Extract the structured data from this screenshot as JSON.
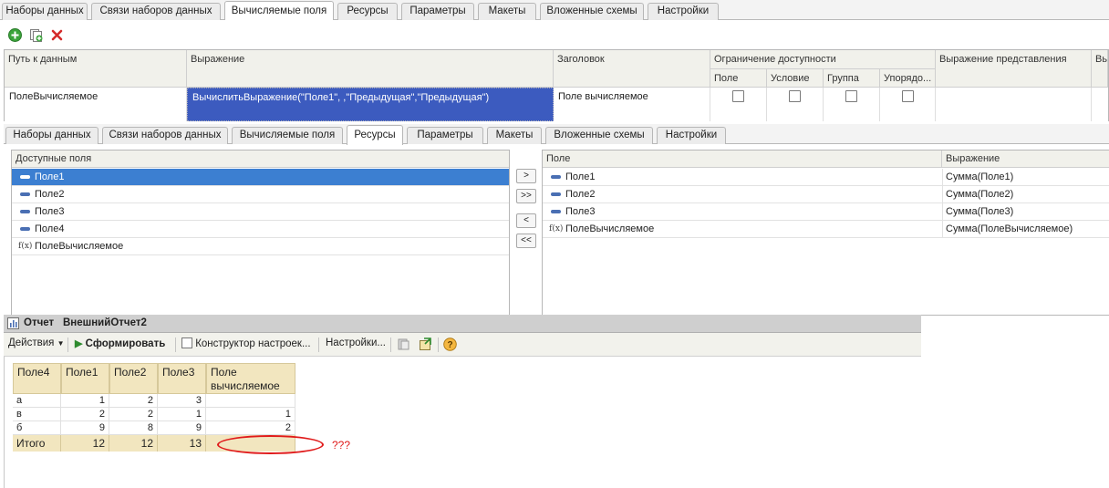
{
  "top_tabs": [
    "Наборы данных",
    "Связи наборов данных",
    "Вычисляемые поля",
    "Ресурсы",
    "Параметры",
    "Макеты",
    "Вложенные схемы",
    "Настройки"
  ],
  "top_active_tab": "Вычисляемые поля",
  "calc_fields": {
    "headers": {
      "path": "Путь к данным",
      "expression": "Выражение",
      "title": "Заголовок",
      "restriction": "Ограничение доступности",
      "restriction_field": "Поле",
      "restriction_condition": "Условие",
      "restriction_group": "Группа",
      "restriction_order": "Упорядо...",
      "presentation": "Выражение представления",
      "cut": "Вы"
    },
    "row": {
      "path": "ПолеВычисляемое",
      "expression": "ВычислитьВыражение(\"Поле1\", ,\"Предыдущая\",\"Предыдущая\")",
      "title": "Поле вычисляемое"
    }
  },
  "inner_tabs": [
    "Наборы данных",
    "Связи наборов данных",
    "Вычисляемые поля",
    "Ресурсы",
    "Параметры",
    "Макеты",
    "Вложенные схемы",
    "Настройки"
  ],
  "inner_active_tab": "Ресурсы",
  "available_fields": {
    "header": "Доступные поля",
    "items": [
      "Поле1",
      "Поле2",
      "Поле3",
      "Поле4",
      "ПолеВычисляемое"
    ]
  },
  "move_buttons": [
    ">",
    ">>",
    "<",
    "<<"
  ],
  "resources": {
    "header_field": "Поле",
    "header_expression": "Выражение",
    "rows": [
      {
        "field": "Поле1",
        "expression": "Сумма(Поле1)"
      },
      {
        "field": "Поле2",
        "expression": "Сумма(Поле2)"
      },
      {
        "field": "Поле3",
        "expression": "Сумма(Поле3)"
      },
      {
        "field": "ПолеВычисляемое",
        "expression": "Сумма(ПолеВычисляемое)"
      }
    ]
  },
  "report": {
    "title_prefix": "Отчет",
    "title": "ВнешнийОтчет2",
    "actions_label": "Действия",
    "generate_label": "Сформировать",
    "constructor_label": "Конструктор настроек...",
    "settings_label": "Настройки..."
  },
  "result_table": {
    "headers": [
      "Поле4",
      "Поле1",
      "Поле2",
      "Поле3",
      "Поле вычисляемое"
    ],
    "rows": [
      [
        "а",
        "1",
        "2",
        "3",
        ""
      ],
      [
        "в",
        "2",
        "2",
        "1",
        "1"
      ],
      [
        "б",
        "9",
        "8",
        "9",
        "2"
      ]
    ],
    "total": [
      "Итого",
      "12",
      "12",
      "13",
      ""
    ]
  },
  "annotation": "???",
  "colors": {
    "selection_blue": "#3c5bbf",
    "row_highlight": "#3c7fd1",
    "table_header": "#f2e6bf",
    "annotation_red": "#e01b1b",
    "add_green": "#3aa33a",
    "delete_red": "#d42a2a"
  }
}
